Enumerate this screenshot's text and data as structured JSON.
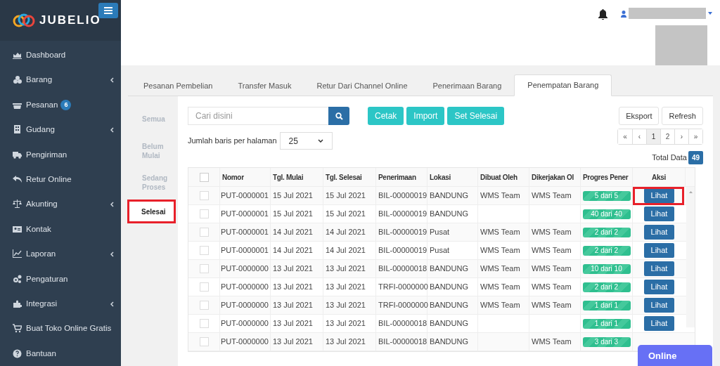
{
  "brand": {
    "name": "JUBELIO"
  },
  "sidebar": {
    "items": [
      {
        "label": "Dashboard",
        "has_submenu": false
      },
      {
        "label": "Barang",
        "has_submenu": true
      },
      {
        "label": "Pesanan",
        "has_submenu": false,
        "badge": "6"
      },
      {
        "label": "Gudang",
        "has_submenu": true
      },
      {
        "label": "Pengiriman",
        "has_submenu": false
      },
      {
        "label": "Retur Online",
        "has_submenu": false
      },
      {
        "label": "Akunting",
        "has_submenu": true
      },
      {
        "label": "Kontak",
        "has_submenu": false
      },
      {
        "label": "Laporan",
        "has_submenu": true
      },
      {
        "label": "Pengaturan",
        "has_submenu": false
      },
      {
        "label": "Integrasi",
        "has_submenu": true
      },
      {
        "label": "Buat Toko Online Gratis",
        "has_submenu": false
      },
      {
        "label": "Bantuan",
        "has_submenu": false
      }
    ]
  },
  "tabs": [
    {
      "label": "Pesanan Pembelian",
      "selected": false
    },
    {
      "label": "Transfer Masuk",
      "selected": false
    },
    {
      "label": "Retur Dari Channel Online",
      "selected": false
    },
    {
      "label": "Penerimaan Barang",
      "selected": false
    },
    {
      "label": "Penempatan Barang",
      "selected": true
    }
  ],
  "status_filters": [
    {
      "label": "Semua",
      "selected": false
    },
    {
      "label": "Belum Mulai",
      "selected": false
    },
    {
      "label": "Sedang Proses",
      "selected": false
    },
    {
      "label": "Selesai",
      "selected": true
    }
  ],
  "search": {
    "placeholder": "Cari disini"
  },
  "actions": [
    "Cetak",
    "Import",
    "Set Selesai"
  ],
  "secondary_actions": [
    "Eksport",
    "Refresh"
  ],
  "rows_per_page": {
    "label": "Jumlah baris per halaman",
    "value": "25"
  },
  "pagination": [
    {
      "label": "«",
      "selected": false
    },
    {
      "label": "‹",
      "selected": false
    },
    {
      "label": "1",
      "selected": true
    },
    {
      "label": "2",
      "selected": false
    },
    {
      "label": "›",
      "selected": false
    },
    {
      "label": "»",
      "selected": false
    }
  ],
  "total": {
    "label": "Total Data",
    "value": "49"
  },
  "table": {
    "all_checked": false,
    "columns": [
      "Nomor",
      "Tgl. Mulai",
      "Tgl. Selesai",
      "Penerimaan",
      "Lokasi",
      "Dibuat Oleh",
      "Dikerjakan Ol",
      "Progres Pener",
      "Aksi"
    ],
    "rows": [
      {
        "checked": false,
        "nomor": "PUT-0000001",
        "mulai": "15 Jul 2021",
        "selesai": "15 Jul 2021",
        "penerimaan": "BIL-00000019",
        "lokasi": "BANDUNG",
        "dibuat": "WMS Team",
        "dikerjakan": "WMS Team",
        "progress": "5 dari 5",
        "level": 1,
        "action": "Lihat",
        "highlighted": true
      },
      {
        "checked": false,
        "nomor": "PUT-0000001",
        "mulai": "15 Jul 2021",
        "selesai": "15 Jul 2021",
        "penerimaan": "BIL-00000019",
        "lokasi": "BANDUNG",
        "progress": "40 dari 40",
        "level": 1,
        "action": "Lihat",
        "highlighted": false
      },
      {
        "checked": false,
        "nomor": "PUT-0000001",
        "mulai": "14 Jul 2021",
        "selesai": "14 Jul 2021",
        "penerimaan": "BIL-00000019",
        "lokasi": "Pusat",
        "dibuat": "WMS Team",
        "dikerjakan": "WMS Team",
        "progress": "2 dari 2",
        "level": 1,
        "action": "Lihat",
        "highlighted": false
      },
      {
        "checked": false,
        "nomor": "PUT-0000001",
        "mulai": "14 Jul 2021",
        "selesai": "14 Jul 2021",
        "penerimaan": "BIL-00000019",
        "lokasi": "Pusat",
        "dibuat": "WMS Team",
        "dikerjakan": "WMS Team",
        "progress": "2 dari 2",
        "level": 1,
        "action": "Lihat",
        "highlighted": false
      },
      {
        "checked": false,
        "nomor": "PUT-0000000",
        "mulai": "13 Jul 2021",
        "selesai": "13 Jul 2021",
        "penerimaan": "BIL-00000018",
        "lokasi": "BANDUNG",
        "dibuat": "WMS Team",
        "dikerjakan": "WMS Team",
        "progress": "10 dari 10",
        "level": 1,
        "action": "Lihat",
        "highlighted": false
      },
      {
        "checked": false,
        "nomor": "PUT-0000000",
        "mulai": "13 Jul 2021",
        "selesai": "13 Jul 2021",
        "penerimaan": "TRFI-0000000",
        "lokasi": "BANDUNG",
        "dibuat": "WMS Team",
        "dikerjakan": "WMS Team",
        "progress": "2 dari 2",
        "level": 1,
        "action": "Lihat",
        "highlighted": false
      },
      {
        "checked": false,
        "nomor": "PUT-0000000",
        "mulai": "13 Jul 2021",
        "selesai": "13 Jul 2021",
        "penerimaan": "TRFI-0000000",
        "lokasi": "BANDUNG",
        "dibuat": "WMS Team",
        "dikerjakan": "WMS Team",
        "progress": "1 dari 1",
        "level": 1,
        "action": "Lihat",
        "highlighted": false
      },
      {
        "checked": false,
        "nomor": "PUT-0000000",
        "mulai": "13 Jul 2021",
        "selesai": "13 Jul 2021",
        "penerimaan": "BIL-00000018",
        "lokasi": "BANDUNG",
        "progress": "1 dari 1",
        "level": 1,
        "action": "Lihat",
        "highlighted": false
      },
      {
        "checked": false,
        "nomor": "PUT-0000000",
        "mulai": "13 Jul 2021",
        "selesai": "13 Jul 2021",
        "penerimaan": "BIL-00000018",
        "lokasi": "BANDUNG",
        "dikerjakan": "WMS Team",
        "progress": "3 dari 3",
        "level": 1,
        "highlighted": false
      }
    ]
  },
  "chat_button": "Online"
}
